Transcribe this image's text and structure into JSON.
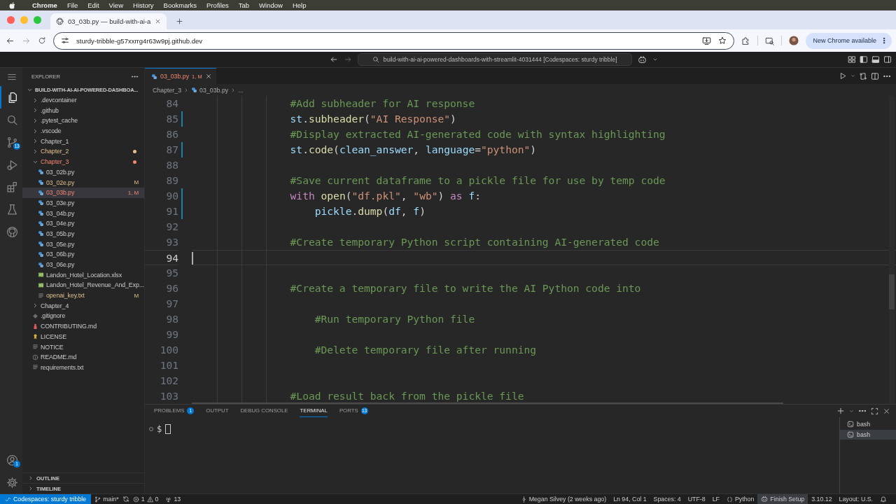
{
  "menubar": {
    "app": "Chrome",
    "items": [
      "File",
      "Edit",
      "View",
      "History",
      "Bookmarks",
      "Profiles",
      "Tab",
      "Window",
      "Help"
    ]
  },
  "browser": {
    "tabs": [
      {
        "title": "03_03b.py — build-with-ai-a",
        "selected": true
      }
    ],
    "url": "sturdy-tribble-g57xxrrg4r63w9pj.github.dev",
    "update_button": "New Chrome available"
  },
  "titlebar": {
    "command_center": "build-with-ai-ai-powered-dashboards-with-streamlit-4031444 [Codespaces: sturdy tribble]"
  },
  "activity_bar": {
    "items": [
      {
        "kind": "explorer",
        "selected": true
      },
      {
        "kind": "search",
        "selected": false
      },
      {
        "kind": "source-control",
        "selected": false,
        "badge": "13"
      },
      {
        "kind": "run-debug",
        "selected": false
      },
      {
        "kind": "extensions",
        "selected": false
      },
      {
        "kind": "testing",
        "selected": false
      },
      {
        "kind": "github",
        "selected": false
      }
    ],
    "bottom": [
      {
        "kind": "accounts",
        "badge": "1"
      },
      {
        "kind": "manage"
      }
    ]
  },
  "explorer": {
    "title": "EXPLORER",
    "tree": [
      {
        "label": "BUILD-WITH-AI-AI-POWERED-DASHBOA...",
        "kind": "root",
        "expanded": true,
        "selected": false,
        "children": [
          {
            "label": ".devcontainer",
            "kind": "folder",
            "expanded": false,
            "selected": false,
            "modified": false,
            "has_errors": false
          },
          {
            "label": ".github",
            "kind": "folder",
            "expanded": false,
            "selected": false,
            "modified": false,
            "has_errors": false
          },
          {
            "label": ".pytest_cache",
            "kind": "folder",
            "expanded": false,
            "selected": false,
            "modified": false,
            "has_errors": false
          },
          {
            "label": ".vscode",
            "kind": "folder",
            "expanded": false,
            "selected": false,
            "modified": false,
            "has_errors": false
          },
          {
            "label": "Chapter_1",
            "kind": "folder",
            "expanded": false,
            "selected": false,
            "modified": false,
            "has_errors": false
          },
          {
            "label": "Chapter_2",
            "kind": "folder",
            "expanded": false,
            "selected": false,
            "modified": true,
            "has_errors": false
          },
          {
            "label": "Chapter_3",
            "kind": "folder",
            "expanded": true,
            "selected": false,
            "has_errors": true,
            "children": [
              {
                "label": "03_02b.py",
                "kind": "python",
                "selected": false,
                "modified": false,
                "has_errors": false
              },
              {
                "label": "03_02e.py",
                "kind": "python",
                "selected": false,
                "modified": true,
                "has_errors": false,
                "badge": "M"
              },
              {
                "label": "03_03b.py",
                "kind": "python",
                "selected": true,
                "has_errors": true,
                "badge": "1, M"
              },
              {
                "label": "03_03e.py",
                "kind": "python",
                "selected": false,
                "modified": false,
                "has_errors": false
              },
              {
                "label": "03_04b.py",
                "kind": "python",
                "selected": false,
                "modified": false,
                "has_errors": false
              },
              {
                "label": "03_04e.py",
                "kind": "python",
                "selected": false,
                "modified": false,
                "has_errors": false
              },
              {
                "label": "03_05b.py",
                "kind": "python",
                "selected": false,
                "modified": false,
                "has_errors": false
              },
              {
                "label": "03_05e.py",
                "kind": "python",
                "selected": false,
                "modified": false,
                "has_errors": false
              },
              {
                "label": "03_06b.py",
                "kind": "python",
                "selected": false,
                "modified": false,
                "has_errors": false
              },
              {
                "label": "03_06e.py",
                "kind": "python",
                "selected": false,
                "modified": false,
                "has_errors": false
              },
              {
                "label": "Landon_Hotel_Location.xlsx",
                "kind": "spreadsheet",
                "selected": false,
                "modified": false,
                "has_errors": false
              },
              {
                "label": "Landon_Hotel_Revenue_And_Exp...",
                "kind": "spreadsheet",
                "selected": false,
                "modified": false,
                "has_errors": false
              },
              {
                "label": "openai_key.txt",
                "kind": "text",
                "selected": false,
                "modified": true,
                "has_errors": false,
                "badge": "M"
              }
            ]
          },
          {
            "label": "Chapter_4",
            "kind": "folder",
            "expanded": false,
            "selected": false,
            "modified": false,
            "has_errors": false
          },
          {
            "label": ".gitignore",
            "kind": "gitignore",
            "selected": false,
            "modified": false,
            "has_errors": false
          },
          {
            "label": "CONTRIBUTING.md",
            "kind": "contributing",
            "selected": false,
            "modified": false,
            "has_errors": false
          },
          {
            "label": "LICENSE",
            "kind": "license",
            "selected": false,
            "modified": false,
            "has_errors": false
          },
          {
            "label": "NOTICE",
            "kind": "text",
            "selected": false,
            "modified": false,
            "has_errors": false
          },
          {
            "label": "README.md",
            "kind": "readme",
            "selected": false,
            "modified": false,
            "has_errors": false
          },
          {
            "label": "requirements.txt",
            "kind": "text",
            "selected": false,
            "modified": false,
            "has_errors": false
          }
        ]
      }
    ],
    "sections": [
      {
        "label": "OUTLINE",
        "expanded": false
      },
      {
        "label": "TIMELINE",
        "expanded": false
      }
    ]
  },
  "editor": {
    "tabs": [
      {
        "label": "03_03b.py",
        "badge": "1, M",
        "has_errors": true,
        "selected": true
      }
    ],
    "breadcrumbs": [
      {
        "label": "Chapter_3",
        "kind": "folder"
      },
      {
        "label": "03_03b.py",
        "kind": "python"
      },
      {
        "label": "...",
        "kind": "symbol"
      }
    ],
    "lines": [
      {
        "number": "84",
        "current": false,
        "changed": false,
        "tokens": [
          {
            "text": "                #Add subheader for AI response",
            "kind": "comment"
          }
        ]
      },
      {
        "number": "85",
        "current": false,
        "changed": true,
        "tokens": [
          {
            "text": "                st",
            "kind": "var"
          },
          {
            "text": ".",
            "kind": "punct"
          },
          {
            "text": "subheader",
            "kind": "func"
          },
          {
            "text": "(",
            "kind": "punct"
          },
          {
            "text": "\"AI Response\"",
            "kind": "str"
          },
          {
            "text": ")",
            "kind": "punct"
          }
        ]
      },
      {
        "number": "86",
        "current": false,
        "changed": false,
        "tokens": [
          {
            "text": "                #Display extracted AI-generated code with syntax highlighting",
            "kind": "comment"
          }
        ]
      },
      {
        "number": "87",
        "current": false,
        "changed": true,
        "tokens": [
          {
            "text": "                st",
            "kind": "var"
          },
          {
            "text": ".",
            "kind": "punct"
          },
          {
            "text": "code",
            "kind": "func"
          },
          {
            "text": "(",
            "kind": "punct"
          },
          {
            "text": "clean_answer",
            "kind": "var"
          },
          {
            "text": ", ",
            "kind": "punct"
          },
          {
            "text": "language",
            "kind": "var"
          },
          {
            "text": "=",
            "kind": "punct"
          },
          {
            "text": "\"python\"",
            "kind": "str"
          },
          {
            "text": ")",
            "kind": "punct"
          }
        ]
      },
      {
        "number": "88",
        "current": false,
        "changed": false
      },
      {
        "number": "89",
        "current": false,
        "changed": false,
        "tokens": [
          {
            "text": "                #Save current dataframe to a pickle file for use by temp code",
            "kind": "comment"
          }
        ]
      },
      {
        "number": "90",
        "current": false,
        "changed": true,
        "tokens": [
          {
            "text": "                with",
            "kind": "kw"
          },
          {
            "text": " open",
            "kind": "func"
          },
          {
            "text": "(",
            "kind": "punct"
          },
          {
            "text": "\"df.pkl\"",
            "kind": "str"
          },
          {
            "text": ", ",
            "kind": "punct"
          },
          {
            "text": "\"wb\"",
            "kind": "str"
          },
          {
            "text": ") ",
            "kind": "punct"
          },
          {
            "text": "as",
            "kind": "kw"
          },
          {
            "text": " f",
            "kind": "var"
          },
          {
            "text": ":",
            "kind": "punct"
          }
        ]
      },
      {
        "number": "91",
        "current": false,
        "changed": true,
        "tokens": [
          {
            "text": "                    pickle",
            "kind": "var"
          },
          {
            "text": ".",
            "kind": "punct"
          },
          {
            "text": "dump",
            "kind": "func"
          },
          {
            "text": "(",
            "kind": "punct"
          },
          {
            "text": "df",
            "kind": "var"
          },
          {
            "text": ", ",
            "kind": "punct"
          },
          {
            "text": "f",
            "kind": "var"
          },
          {
            "text": ")",
            "kind": "punct"
          }
        ]
      },
      {
        "number": "92",
        "current": false,
        "changed": false
      },
      {
        "number": "93",
        "current": false,
        "changed": false,
        "tokens": [
          {
            "text": "                #Create temporary Python script containing AI-generated code",
            "kind": "comment"
          }
        ]
      },
      {
        "number": "94",
        "current": true,
        "changed": false
      },
      {
        "number": "95",
        "current": false,
        "changed": false
      },
      {
        "number": "96",
        "current": false,
        "changed": false,
        "tokens": [
          {
            "text": "                #Create a temporary file to write the AI Python code into",
            "kind": "comment"
          }
        ]
      },
      {
        "number": "97",
        "current": false,
        "changed": false
      },
      {
        "number": "98",
        "current": false,
        "changed": false,
        "tokens": [
          {
            "text": "                    #Run temporary Python file",
            "kind": "comment"
          }
        ]
      },
      {
        "number": "99",
        "current": false,
        "changed": false
      },
      {
        "number": "100",
        "current": false,
        "changed": false,
        "tokens": [
          {
            "text": "                    #Delete temporary file after running",
            "kind": "comment"
          }
        ]
      },
      {
        "number": "101",
        "current": false,
        "changed": false
      },
      {
        "number": "102",
        "current": false,
        "changed": false
      },
      {
        "number": "103",
        "current": false,
        "changed": false,
        "tokens": [
          {
            "text": "                #Load result back from the pickle file",
            "kind": "comment"
          }
        ]
      }
    ]
  },
  "panel": {
    "tabs": [
      {
        "label": "PROBLEMS",
        "badge": "1",
        "selected": false
      },
      {
        "label": "OUTPUT",
        "selected": false
      },
      {
        "label": "DEBUG CONSOLE",
        "selected": false
      },
      {
        "label": "TERMINAL",
        "selected": true
      },
      {
        "label": "PORTS",
        "badge": "13",
        "selected": false
      }
    ],
    "prompt": "$",
    "terminals": [
      {
        "label": "bash",
        "selected": false
      },
      {
        "label": "bash",
        "selected": true
      }
    ]
  },
  "status_bar": {
    "remote": "Codespaces: sturdy tribble",
    "branch": "main*",
    "errors": "1",
    "warnings": "0",
    "ports": "13",
    "right": [
      {
        "kind": "blame",
        "text": "Megan Silvey (2 weeks ago)"
      },
      {
        "kind": "text",
        "text": "Ln 94, Col 1"
      },
      {
        "kind": "text",
        "text": "Spaces: 4"
      },
      {
        "kind": "text",
        "text": "UTF-8"
      },
      {
        "kind": "text",
        "text": "LF"
      },
      {
        "kind": "language",
        "text": "Python"
      },
      {
        "kind": "copilot",
        "text": "Finish Setup"
      },
      {
        "kind": "text",
        "text": "3.10.12"
      },
      {
        "kind": "text",
        "text": "Layout: U.S."
      },
      {
        "kind": "bell"
      }
    ]
  }
}
